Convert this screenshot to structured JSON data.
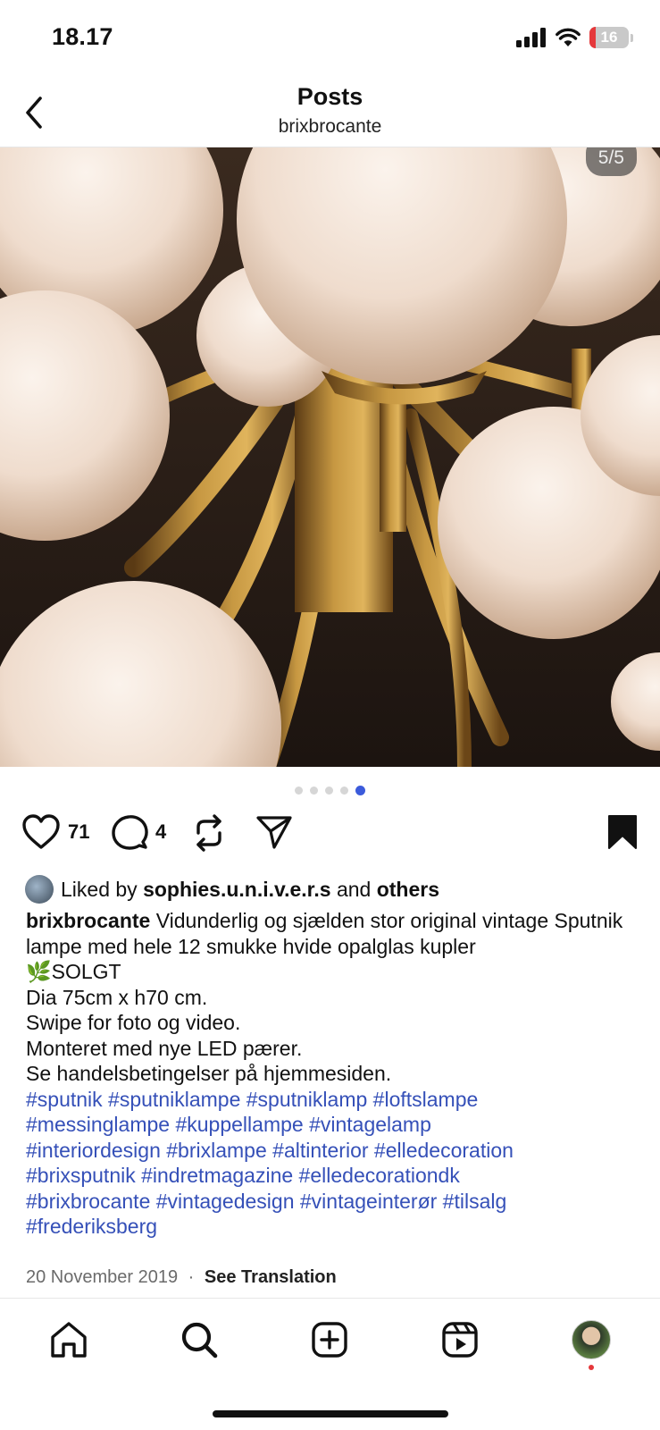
{
  "status": {
    "time": "18.17",
    "battery": "16"
  },
  "header": {
    "title": "Posts",
    "subtitle": "brixbrocante"
  },
  "carousel": {
    "counter": "5/5",
    "total": 5,
    "active_index": 5
  },
  "actions": {
    "likes": "71",
    "comments": "4"
  },
  "liked_by": {
    "prefix": "Liked by",
    "user": "sophies.u.n.i.v.e.r.s",
    "and": "and",
    "others": "others"
  },
  "caption": {
    "username": "brixbrocante",
    "line1": " Vidunderlig og sjælden stor original vintage Sputnik lampe med hele 12 smukke hvide opalglas kupler",
    "emoji": "🌿",
    "sold": "SOLGT",
    "line2": "Dia 75cm x h70 cm.",
    "line3": "Swipe for foto og video.",
    "line4": "Monteret med nye LED pærer.",
    "line5": "Se handelsbetingelser på hjemmesiden.",
    "hashtags": [
      "#sputnik #sputniklampe #sputniklamp #loftslampe",
      "#messinglampe #kuppellampe #vintagelamp",
      "#interiordesign #brixlampe #altinterior #elledecoration",
      "#brixsputnik #indretmagazine #elledecorationdk",
      "#brixbrocante #vintagedesign #vintageinterør #tilsalg",
      "#frederiksberg"
    ]
  },
  "meta": {
    "date": "20 November 2019",
    "sep": "·",
    "translate": "See Translation"
  },
  "icons": {
    "back": "chevron-left-icon",
    "like": "heart-icon",
    "comment": "comment-bubble-icon",
    "repost": "repost-icon",
    "share": "paper-plane-icon",
    "save": "bookmark-filled-icon",
    "home": "home-icon",
    "search": "search-icon",
    "create": "plus-square-icon",
    "reels": "reels-icon"
  },
  "colors": {
    "link": "#3550b8",
    "dot_active": "#3b5bdb",
    "notification": "#e5383b"
  }
}
